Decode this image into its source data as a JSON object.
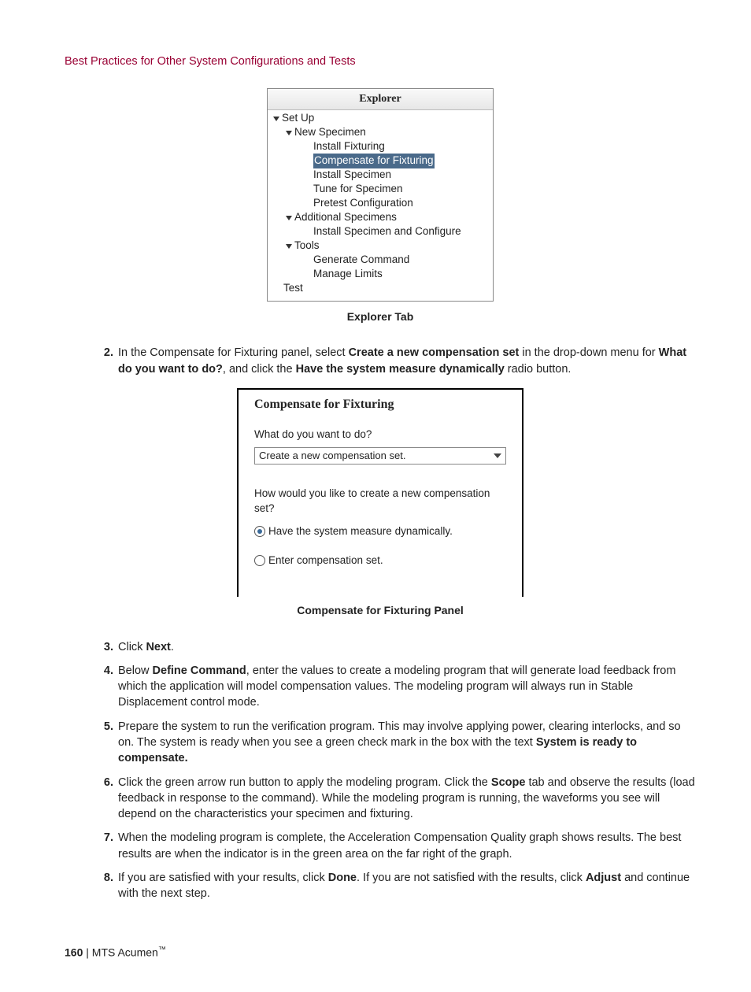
{
  "header": {
    "breadcrumb": "Best Practices for Other System Configurations and Tests"
  },
  "explorer": {
    "title": "Explorer",
    "tree": {
      "setUp": "Set Up",
      "newSpecimen": "New Specimen",
      "installFixturing": "Install Fixturing",
      "compensateForFixturing": "Compensate for Fixturing",
      "installSpecimen": "Install Specimen",
      "tuneForSpecimen": "Tune for Specimen",
      "pretestConfiguration": "Pretest Configuration",
      "additionalSpecimens": "Additional Specimens",
      "installSpecimenAndConfigure": "Install Specimen and Configure",
      "tools": "Tools",
      "generateCommand": "Generate Command",
      "manageLimits": "Manage Limits",
      "test": "Test"
    },
    "caption": "Explorer Tab"
  },
  "step2": {
    "pre": "In the Compensate for Fixturing panel, select ",
    "bold1": "Create a new compensation set",
    "mid1": " in the drop-down menu for ",
    "bold2": "What do you want to do?",
    "mid2": ", and click the ",
    "bold3": "Have the system measure dynamically",
    "post": " radio button."
  },
  "compPanel": {
    "title": "Compensate for Fixturing",
    "q1": "What do you want to do?",
    "dropdownValue": "Create a new compensation set.",
    "q2": "How would you like to create a new compensation set?",
    "radio1": "Have the system measure dynamically.",
    "radio2": "Enter compensation set.",
    "caption": "Compensate for Fixturing Panel"
  },
  "step3": {
    "pre": "Click ",
    "bold": "Next",
    "post": "."
  },
  "step4": {
    "pre": "Below ",
    "bold": "Define Command",
    "post": ", enter the values to create a modeling program that will generate load feedback from which the application will model compensation values. The modeling program will always run in Stable Displacement control mode."
  },
  "step5": {
    "pre": "Prepare the system to run the verification program. This may involve applying power, clearing interlocks, and so on. The system is ready when you see a green check mark in the box with the text ",
    "bold": "System is ready to compensate."
  },
  "step6": {
    "pre": "Click the green arrow run button to apply the modeling program. Click the ",
    "bold": "Scope",
    "post": " tab and observe the results (load feedback in response to the command). While the modeling program is running, the waveforms you see will depend on the characteristics your specimen and fixturing."
  },
  "step7": {
    "text": "When the modeling program is complete, the Acceleration Compensation Quality graph shows results. The best results are when the indicator is in the green area on the far right of the graph."
  },
  "step8": {
    "pre": "If you are satisfied with your results, click ",
    "bold1": "Done",
    "mid": ". If you are not satisfied with the results, click ",
    "bold2": "Adjust",
    "post": " and continue with the next step."
  },
  "footer": {
    "page": "160",
    "sep": " | ",
    "product": "MTS Acumen",
    "tm": "™"
  },
  "nums": {
    "n2": "2.",
    "n3": "3.",
    "n4": "4.",
    "n5": "5.",
    "n6": "6.",
    "n7": "7.",
    "n8": "8."
  }
}
